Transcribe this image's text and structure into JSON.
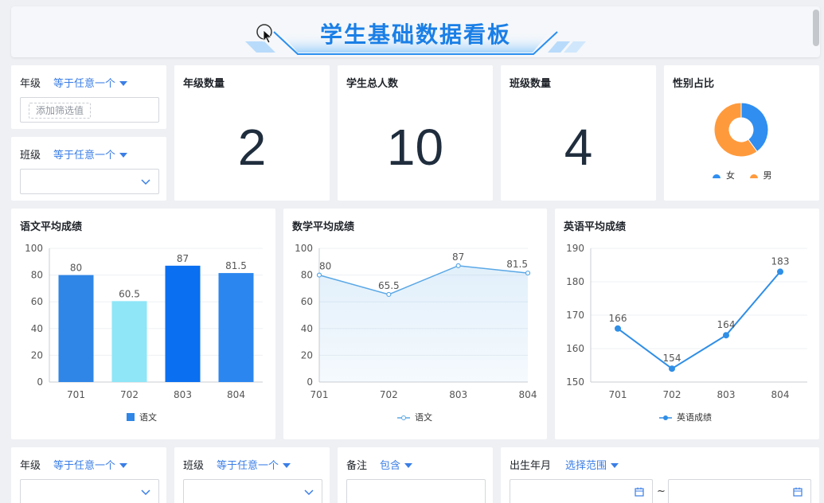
{
  "header": {
    "title": "学生基础数据看板"
  },
  "filters_top": [
    {
      "label": "年级",
      "op": "等于任意一个",
      "placeholder": "添加筛选值"
    },
    {
      "label": "班级",
      "op": "等于任意一个"
    }
  ],
  "kpis": [
    {
      "title": "年级数量",
      "value": "2"
    },
    {
      "title": "学生总人数",
      "value": "10"
    },
    {
      "title": "班级数量",
      "value": "4"
    }
  ],
  "gender": {
    "title": "性别占比",
    "legend": [
      "女",
      "男"
    ],
    "colors": {
      "female": "#2f8ef0",
      "male": "#ff9a3c"
    }
  },
  "filters_bottom": [
    {
      "label": "年级",
      "op": "等于任意一个"
    },
    {
      "label": "班级",
      "op": "等于任意一个"
    },
    {
      "label": "备注",
      "op": "包含"
    },
    {
      "label": "出生年月",
      "op": "选择范围",
      "separator": "~"
    }
  ],
  "chart_data": [
    {
      "type": "pie",
      "title": "性别占比",
      "categories": [
        "女",
        "男"
      ],
      "values": [
        40,
        60
      ],
      "colors": [
        "#2f8ef0",
        "#ff9a3c"
      ],
      "legend": "bottom"
    },
    {
      "type": "bar",
      "title": "语文平均成绩",
      "categories": [
        "701",
        "702",
        "803",
        "804"
      ],
      "values": [
        80,
        60.5,
        87,
        81.5
      ],
      "labels": [
        "80",
        "60.5",
        "87",
        "81.5"
      ],
      "yticks": [
        "0",
        "20",
        "40",
        "60",
        "80",
        "100"
      ],
      "ylim": [
        0,
        100
      ],
      "legend": "语文",
      "colors": [
        "#2f86e6",
        "#8ee6f7",
        "#0a6ff0",
        "#2b86ef"
      ]
    },
    {
      "type": "area",
      "title": "数学平均成绩",
      "categories": [
        "701",
        "702",
        "803",
        "804"
      ],
      "values": [
        80,
        65.5,
        87,
        81.5
      ],
      "labels": [
        "80",
        "65.5",
        "87",
        "81.5"
      ],
      "yticks": [
        "0",
        "20",
        "40",
        "60",
        "80",
        "100"
      ],
      "ylim": [
        0,
        100
      ],
      "legend": "语文",
      "color": "#5aa8e6"
    },
    {
      "type": "line",
      "title": "英语平均成绩",
      "categories": [
        "701",
        "702",
        "803",
        "804"
      ],
      "values": [
        166,
        154,
        164,
        183
      ],
      "labels": [
        "166",
        "154",
        "164",
        "183"
      ],
      "yticks": [
        "150",
        "160",
        "170",
        "180",
        "190"
      ],
      "ylim": [
        150,
        190
      ],
      "legend": "英语成绩",
      "color": "#2f8ee6"
    }
  ]
}
